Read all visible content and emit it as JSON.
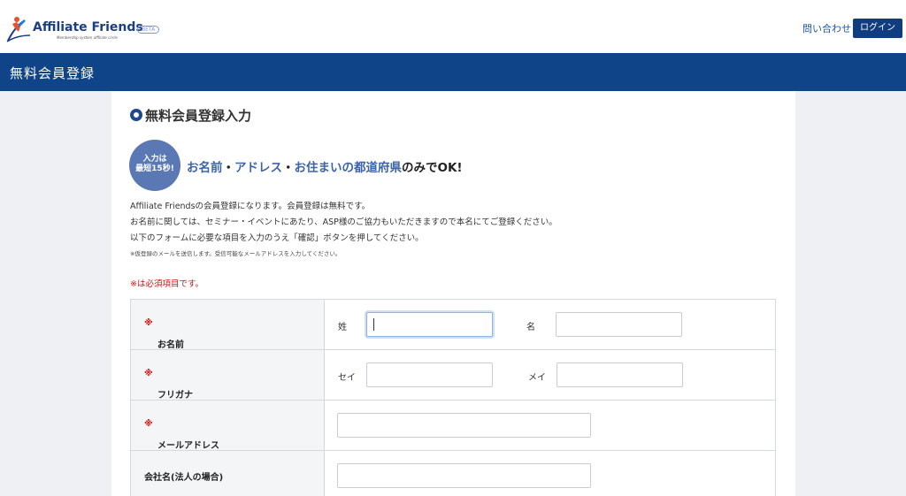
{
  "header": {
    "logo_name": "Affiliate Friends",
    "logo_tagline": "Membership system affiliate circle",
    "logo_badge": "BETA",
    "contact_label": "問い合わせ",
    "login_label": "ログイン"
  },
  "banner": {
    "title": "無料会員登録"
  },
  "section": {
    "title": "無料会員登録入力",
    "badge_line1": "入力は",
    "badge_line2": "最短15秒!",
    "headline_parts": {
      "p1": "お名前",
      "sep1": "・",
      "p2": "アドレス",
      "sep2": "・",
      "p3": "お住まいの都道府県",
      "tail": "のみでOK!"
    },
    "desc_lines": [
      "Affiliate Friendsの会員登録になります。会員登録は無料です。",
      "お名前に関しては、セミナー・イベントにあたり、ASP様のご協力もいただきますので本名にてご登録ください。",
      "以下のフォームに必要な項目を入力のうえ「確認」ボタンを押してください。"
    ],
    "small_note": "※仮登録のメールを送信します。受信可能なメールアドレスを入力してください。",
    "required_note": "※は必須項目です。"
  },
  "form": {
    "required_mark": "※",
    "name": {
      "label": "お名前",
      "last_label": "姓",
      "first_label": "名",
      "last_value": "",
      "first_value": ""
    },
    "kana": {
      "label": "フリガナ",
      "last_label": "セイ",
      "first_label": "メイ",
      "last_value": "",
      "first_value": ""
    },
    "email": {
      "label": "メールアドレス",
      "value": ""
    },
    "company": {
      "label": "会社名(法人の場合)",
      "value": ""
    }
  },
  "colors": {
    "brand": "#0f4488",
    "accent": "#3d64a8",
    "required": "#dd1111"
  }
}
